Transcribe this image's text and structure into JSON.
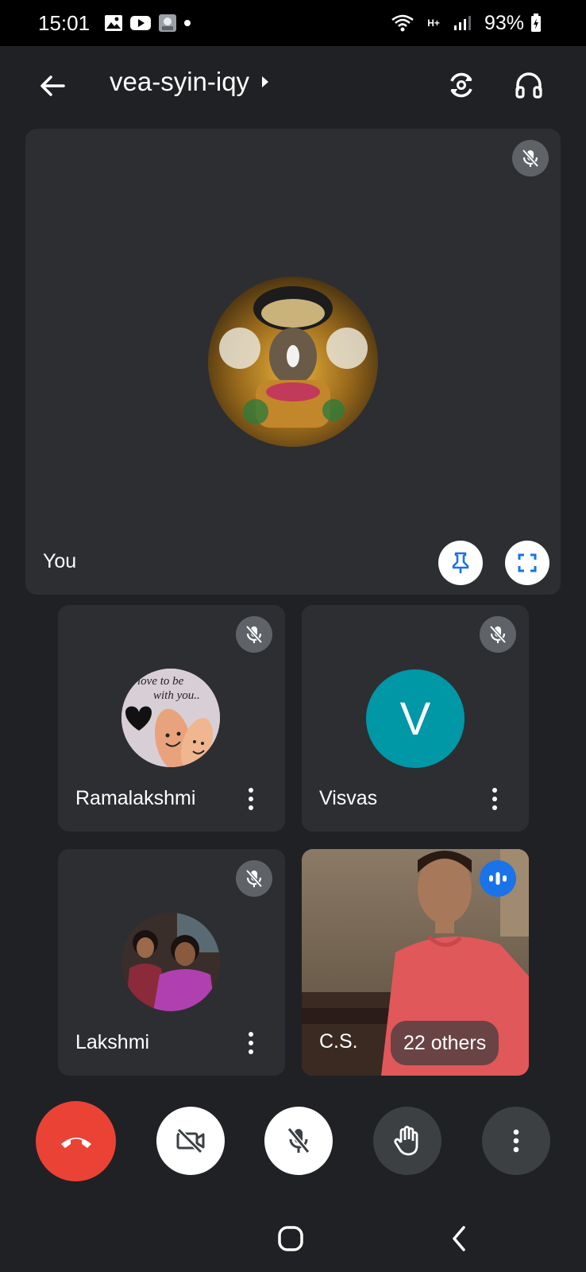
{
  "status_bar": {
    "time": "15:01",
    "battery": "93%",
    "network": "H+",
    "icons": [
      "image-icon",
      "youtube-icon",
      "app-thumbnail-icon",
      "dot-icon",
      "wifi-icon",
      "signal-icon",
      "battery-charging-icon"
    ]
  },
  "app_bar": {
    "meeting_code": "vea-syin-iqy",
    "icons": [
      "back-arrow-icon",
      "chevron-right-icon",
      "switch-camera-icon",
      "headphones-icon"
    ]
  },
  "main_tile": {
    "name": "You",
    "muted": true,
    "avatar_colors": [
      "#6b3f1a",
      "#d4a22f",
      "#2f7a3a"
    ]
  },
  "participants": [
    {
      "name": "Ramalakshmi",
      "muted": true,
      "avatar_type": "photo",
      "avatar_text": "love to be with you..."
    },
    {
      "name": "Visvas",
      "muted": true,
      "avatar_type": "initial",
      "initial": "V",
      "avatar_color": "#0097a7"
    },
    {
      "name": "Lakshmi",
      "muted": true,
      "avatar_type": "photo"
    },
    {
      "name": "C.S.",
      "speaking": true,
      "avatar_type": "video"
    }
  ],
  "others_label": "22 others",
  "controls": {
    "end_call_color": "#ea4335",
    "icons": [
      "end-call-icon",
      "camera-off-icon",
      "mic-off-icon",
      "raise-hand-icon",
      "more-options-icon"
    ]
  },
  "nav_bar": {
    "icons": [
      "home-icon",
      "back-icon"
    ]
  }
}
